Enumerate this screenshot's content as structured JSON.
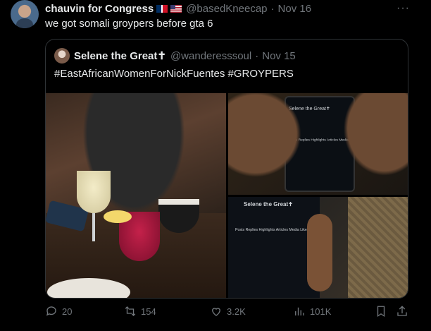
{
  "post": {
    "author_name": "chauvin for Congress",
    "flags": [
      "dominican-republic-flag",
      "us-flag"
    ],
    "handle": "@basedKneecap",
    "separator": "·",
    "date": "Nov 16",
    "more": "···",
    "text": "we got somali groypers before gta 6"
  },
  "quote": {
    "author_name": "Selene the Great✝",
    "handle": "@wanderesssoul",
    "separator": "·",
    "date": "Nov 15",
    "text": "#EastAfricanWomenForNickFuentes #GROYPERS",
    "images": [
      "photo-restaurant-table-drinks",
      "photo-hands-holding-phone",
      "photo-phone-screen-profile"
    ],
    "screen_text": {
      "top_name": "Selene the Great✝",
      "top_tabs": "Posts  Replies  Highlights  Articles  Media  Likes",
      "bottom_name": "Selene the Great✝",
      "bottom_tabs": "Posts  Replies  Highlights  Articles  Media  Likes"
    }
  },
  "actions": {
    "replies": "20",
    "reposts": "154",
    "likes": "3.2K",
    "views": "101K"
  }
}
